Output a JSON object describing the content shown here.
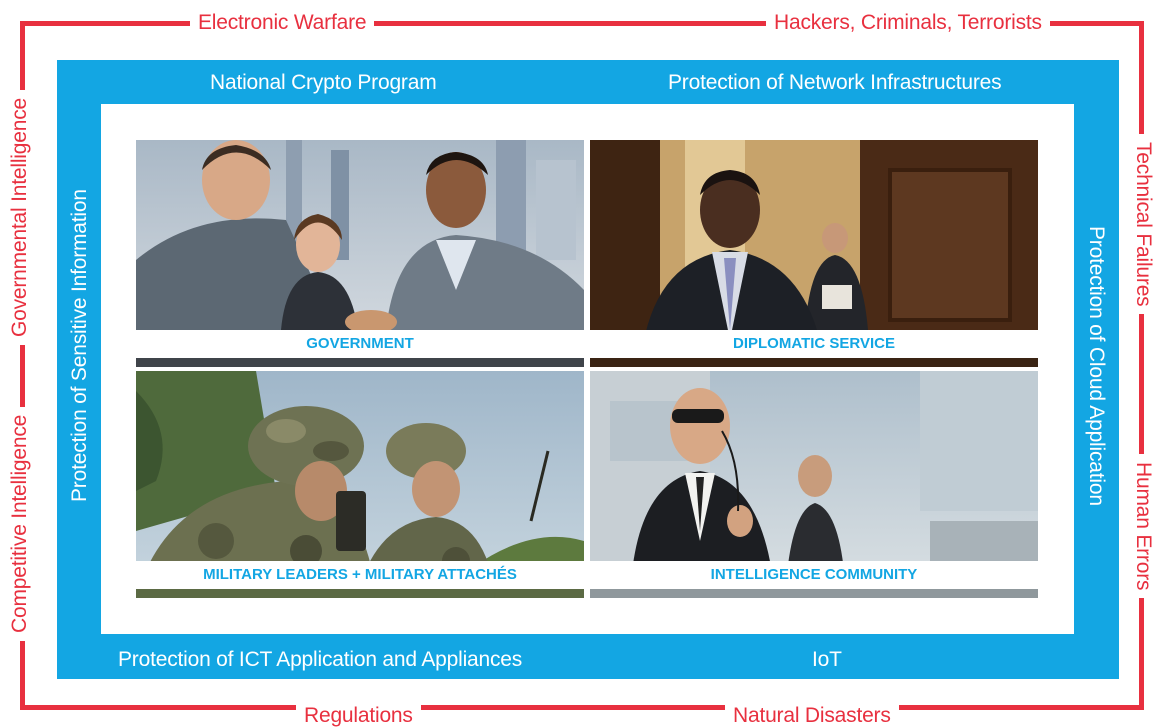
{
  "outer_threats": {
    "top_left": "Electronic Warfare",
    "top_right": "Hackers, Criminals, Terrorists",
    "left_top": "Governmental Intelligence",
    "left_bottom": "Competitive Intelligence",
    "right_top": "Technical Failures",
    "right_bottom": "Human Errors",
    "bottom_left": "Regulations",
    "bottom_right": "Natural Disasters"
  },
  "protection_layers": {
    "top_left": "National Crypto Program",
    "top_right": "Protection of Network Infrastructures",
    "left": "Protection of Sensitive Information",
    "right": "Protection of Cloud Application",
    "bottom_left": "Protection of ICT Application and Appliances",
    "bottom_right": "IoT"
  },
  "sectors": [
    {
      "caption": "GOVERNMENT",
      "icon": "business-handshake-photo"
    },
    {
      "caption": "DIPLOMATIC SERVICE",
      "icon": "diplomat-doorway-photo"
    },
    {
      "caption": "MILITARY LEADERS + MILITARY ATTACHÉS",
      "icon": "soldiers-photo"
    },
    {
      "caption": "INTELLIGENCE COMMUNITY",
      "icon": "security-agent-photo"
    }
  ],
  "colors": {
    "threat_red": "#e8303f",
    "protection_blue": "#13a6e3",
    "background": "#ffffff"
  }
}
